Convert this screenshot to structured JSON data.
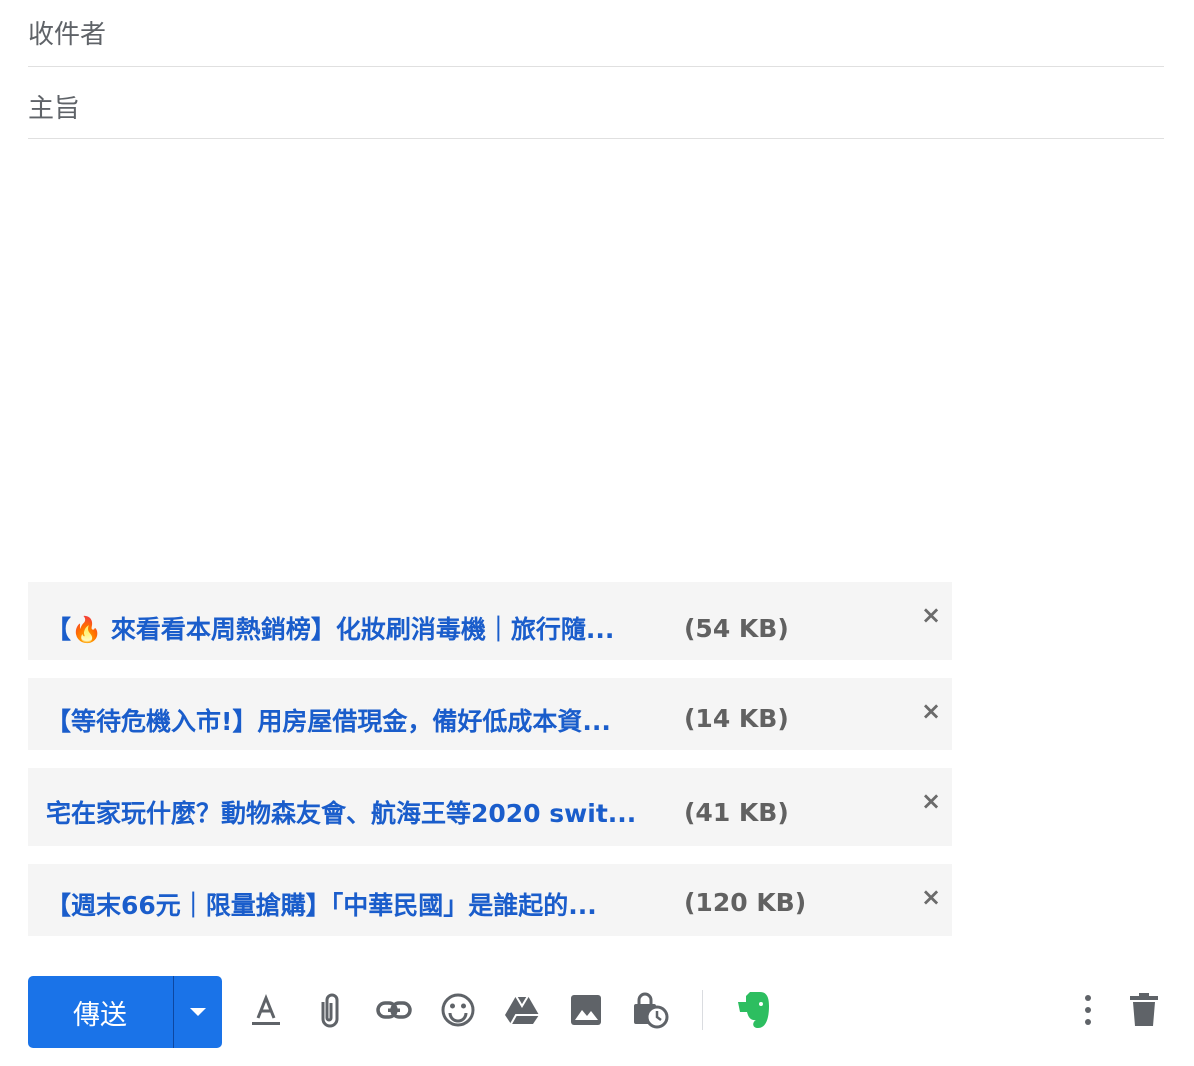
{
  "compose": {
    "to_label": "收件者",
    "subject_label": "主旨"
  },
  "attachments": [
    {
      "name": "【🔥 來看看本周熱銷榜】化妝刷消毒機｜旅行隨...",
      "size": "(54 KB)"
    },
    {
      "name": "【等待危機入市!】用房屋借現金，備好低成本資...",
      "size": "(14 KB)"
    },
    {
      "name": "宅在家玩什麼？動物森友會、航海王等2020 swit...",
      "size": "(41 KB)"
    },
    {
      "name": "【週末66元｜限量搶購】「中華民國」是誰起的...",
      "size": "(120 KB)"
    }
  ],
  "toolbar": {
    "send_label": "傳送",
    "icons": [
      "format-text-icon",
      "attach-file-icon",
      "insert-link-icon",
      "insert-emoji-icon",
      "google-drive-icon",
      "insert-photo-icon",
      "confidential-mode-icon",
      "evernote-icon",
      "more-options-icon",
      "discard-draft-icon"
    ]
  },
  "colors": {
    "send_button": "#1a73e8",
    "attachment_link": "#1a5dcb",
    "attachment_bg": "#f5f5f5",
    "evernote": "#2dbe60"
  }
}
